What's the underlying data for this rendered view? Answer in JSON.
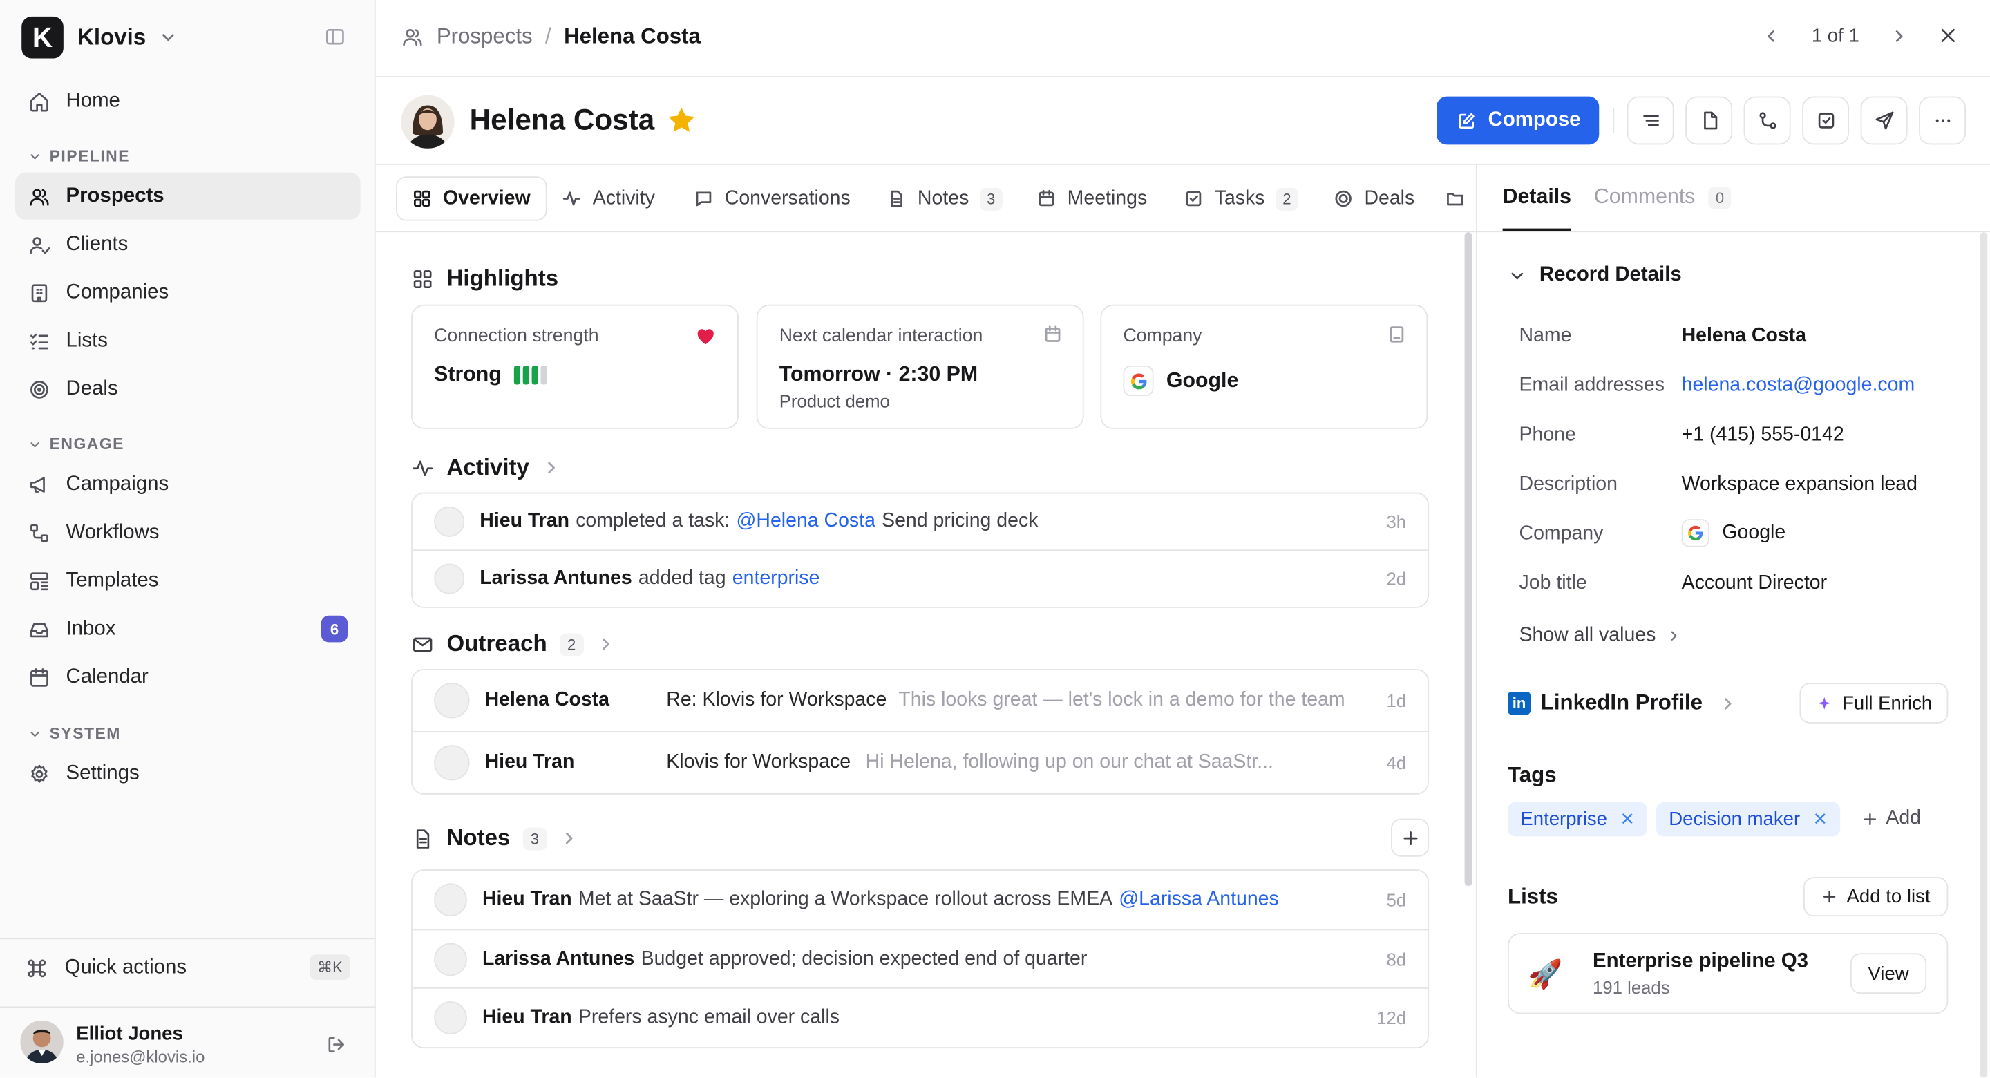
{
  "brand": {
    "name": "Klovis",
    "logo_letter": "K"
  },
  "sidebar": {
    "home": "Home",
    "sections": {
      "pipeline": "PIPELINE",
      "engage": "ENGAGE",
      "system": "SYSTEM"
    },
    "items": {
      "prospects": "Prospects",
      "clients": "Clients",
      "companies": "Companies",
      "lists": "Lists",
      "deals": "Deals",
      "campaigns": "Campaigns",
      "workflows": "Workflows",
      "templates": "Templates",
      "inbox": "Inbox",
      "inbox_badge": "6",
      "calendar": "Calendar",
      "settings": "Settings"
    },
    "quick_actions": "Quick actions",
    "quick_shortcut": "⌘K",
    "user": {
      "name": "Elliot Jones",
      "email": "e.jones@klovis.io"
    }
  },
  "topbar": {
    "breadcrumb_parent": "Prospects",
    "breadcrumb_sep": "/",
    "breadcrumb_current": "Helena Costa",
    "pager": "1 of 1"
  },
  "record": {
    "name": "Helena Costa",
    "compose_label": "Compose"
  },
  "tabs": [
    {
      "label": "Overview"
    },
    {
      "label": "Activity"
    },
    {
      "label": "Conversations"
    },
    {
      "label": "Notes",
      "count": "3"
    },
    {
      "label": "Meetings"
    },
    {
      "label": "Tasks",
      "count": "2"
    },
    {
      "label": "Deals"
    }
  ],
  "highlights": {
    "title": "Highlights",
    "connection": {
      "label": "Connection strength",
      "value": "Strong",
      "level": 3,
      "max": 4
    },
    "next_interaction": {
      "label": "Next calendar interaction",
      "value": "Tomorrow · 2:30 PM",
      "sub": "Product demo"
    },
    "company": {
      "label": "Company",
      "value": "Google"
    }
  },
  "activity": {
    "title": "Activity",
    "rows": [
      {
        "who": "Hieu Tran",
        "text": "completed a task:",
        "mention": "@Helena Costa",
        "rest": "Send pricing deck",
        "time": "3h"
      },
      {
        "who": "Larissa Antunes",
        "text": "added tag",
        "mention": "enterprise",
        "rest": "",
        "time": "2d"
      }
    ]
  },
  "outreach": {
    "title": "Outreach",
    "count": "2",
    "rows": [
      {
        "who": "Helena Costa",
        "subject": "Re: Klovis for Workspace",
        "preview": "This looks great — let's lock in a demo for the team",
        "time": "1d"
      },
      {
        "who": "Hieu Tran",
        "subject": "Klovis for Workspace",
        "preview": "Hi Helena, following up on our chat at SaaStr...",
        "time": "4d"
      }
    ]
  },
  "notes": {
    "title": "Notes",
    "count": "3",
    "rows": [
      {
        "who": "Hieu Tran",
        "text": "Met at SaaStr — exploring a Workspace rollout across EMEA",
        "mention": "@Larissa Antunes",
        "time": "5d"
      },
      {
        "who": "Larissa Antunes",
        "text": "Budget approved; decision expected end of quarter",
        "mention": "",
        "time": "8d"
      },
      {
        "who": "Hieu Tran",
        "text": "Prefers async email over calls",
        "mention": "",
        "time": "12d"
      }
    ]
  },
  "right_panel": {
    "tabs": {
      "details": "Details",
      "comments": "Comments",
      "comments_count": "0"
    },
    "record_details_title": "Record Details",
    "fields": [
      {
        "key": "Name",
        "value": "Helena Costa"
      },
      {
        "key": "Email addresses",
        "value": "helena.costa@google.com"
      },
      {
        "key": "Phone",
        "value": "+1 (415) 555-0142"
      },
      {
        "key": "Description",
        "value": "Workspace expansion lead"
      },
      {
        "key": "Company",
        "value": "Google"
      },
      {
        "key": "Job title",
        "value": "Account Director"
      }
    ],
    "show_all": "Show all values",
    "linkedin_title": "LinkedIn Profile",
    "linkedin_logo": "in",
    "full_enrich": "Full Enrich",
    "tags_title": "Tags",
    "tags": [
      "Enterprise",
      "Decision maker"
    ],
    "tag_add": "Add",
    "lists_title": "Lists",
    "add_to_list": "Add to list",
    "list_entry": {
      "name": "Enterprise pipeline Q3",
      "sub": "191 leads",
      "view": "View",
      "icon": "🚀"
    }
  },
  "colors": {
    "accent": "#2563eb",
    "badge": "#5b5bd6",
    "strength": "#16a34a",
    "heart": "#e11d48",
    "star": "#f5b301"
  }
}
